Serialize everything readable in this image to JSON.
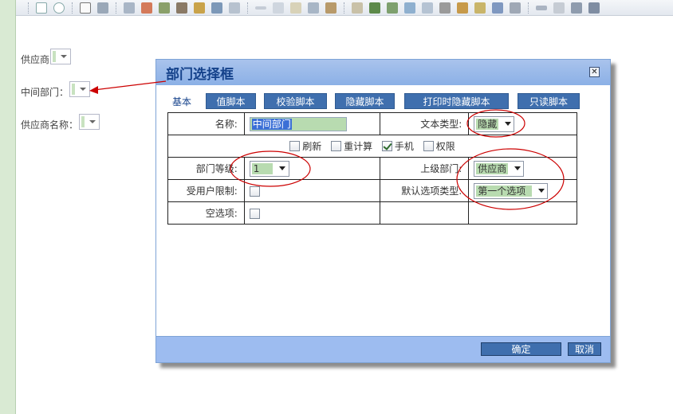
{
  "background_form": {
    "supplier_label": "供应商",
    "dept_label": "中间部门：",
    "supplier_name_label": "供应商名称："
  },
  "dialog": {
    "title": "部门选择框",
    "close_glyph": "✕",
    "tabs": [
      {
        "label": "基本",
        "active": true
      },
      {
        "label": "值脚本"
      },
      {
        "label": "校验脚本"
      },
      {
        "label": "隐藏脚本"
      },
      {
        "label": "打印时隐藏脚本"
      },
      {
        "label": "只读脚本"
      }
    ],
    "form": {
      "name_label": "名称:",
      "name_value": "中间部门",
      "text_type_label": "文本类型:",
      "text_type_value": "隐藏",
      "options": [
        {
          "label": "刷新",
          "checked": false
        },
        {
          "label": "重计算",
          "checked": false
        },
        {
          "label": "手机",
          "checked": true
        },
        {
          "label": "权限",
          "checked": false
        }
      ],
      "dept_level_label": "部门等级:",
      "dept_level_value": "1",
      "parent_dept_label": "上级部门:",
      "parent_dept_value": "供应商",
      "user_limit_label": "受用户限制:",
      "user_limit_checked": false,
      "default_option_type_label": "默认选项类型:",
      "default_option_type_value": "第一个选项",
      "empty_option_label": "空选项:",
      "empty_option_checked": false
    },
    "footer": {
      "ok_label": "确定",
      "cancel_label": "取消"
    }
  },
  "colors": {
    "dialog_title_bg": "#8bb0e6",
    "tab_bg": "#3f6fae",
    "annotation_red": "#cc0000",
    "field_fill": "#b8dbb0"
  }
}
